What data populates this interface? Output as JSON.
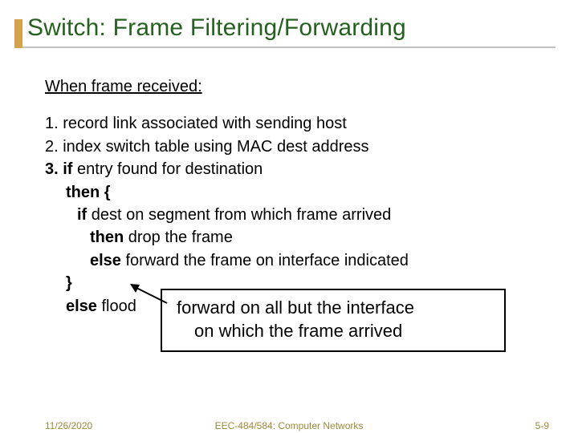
{
  "title": "Switch: Frame Filtering/Forwarding",
  "received_label": "When  frame received:",
  "steps": {
    "s1": "1. record link associated with sending host",
    "s2": "2. index switch table using MAC dest address",
    "s3_if": "3. if",
    "s3_rest": " entry found for destination",
    "then_open": "then {",
    "if2": "if",
    "if2_rest": " dest on segment from which frame arrived",
    "then_drop_kw": "then",
    "then_drop_rest": " drop the frame",
    "else_fwd_kw": "else",
    "else_fwd_rest": " forward the frame on interface indicated",
    "close_brace": "}",
    "else_flood_kw": "else",
    "else_flood_rest": " flood"
  },
  "callout": {
    "line1": "forward on all but the interface",
    "line2": "on which the frame arrived"
  },
  "footer": {
    "date": "11/26/2020",
    "course": "EEC-484/584: Computer Networks",
    "page": "5-9"
  }
}
